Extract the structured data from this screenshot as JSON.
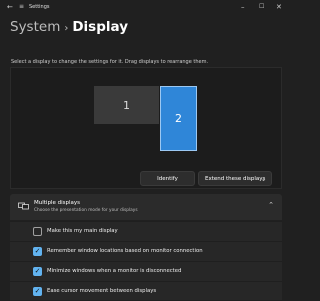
{
  "window": {
    "title": "Settings"
  },
  "header": {
    "parent": "System",
    "separator": "›",
    "current": "Display"
  },
  "arrange": {
    "instruction": "Select a display to change the settings for it. Drag displays to rearrange them.",
    "monitors": [
      {
        "label": "1",
        "selected": false
      },
      {
        "label": "2",
        "selected": true
      }
    ],
    "identify_label": "Identify",
    "mode_label": "Extend these displays"
  },
  "multiple_displays": {
    "title": "Multiple displays",
    "subtitle": "Choose the presentation mode for your displays",
    "options": [
      {
        "label": "Make this my main display",
        "checked": false
      },
      {
        "label": "Remember window locations based on monitor connection",
        "checked": true
      },
      {
        "label": "Minimize windows when a monitor is disconnected",
        "checked": true
      },
      {
        "label": "Ease cursor movement between displays",
        "checked": true
      }
    ]
  },
  "colors": {
    "accent": "#2f86d8",
    "checkbox": "#62b3f0",
    "background": "#202020"
  }
}
